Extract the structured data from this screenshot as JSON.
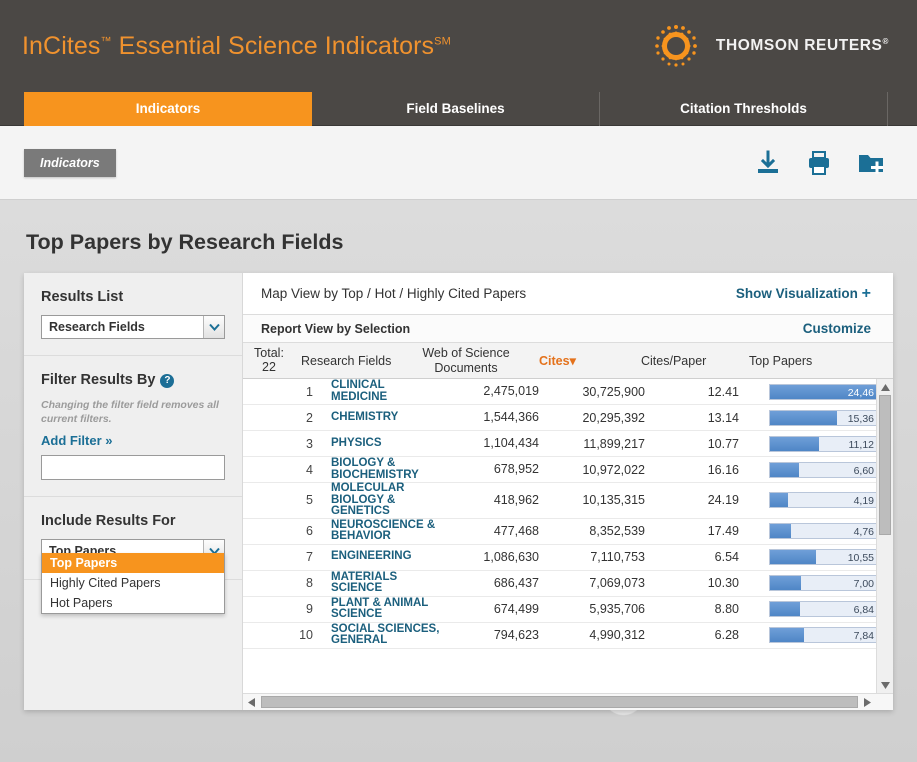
{
  "brand": {
    "product_incites": "InCites",
    "product_tm": "™",
    "product_esi": " Essential Science Indicators",
    "product_sm": "SM",
    "company": "THOMSON REUTERS",
    "company_tm": "®"
  },
  "tabs": [
    {
      "label": "Indicators",
      "active": true
    },
    {
      "label": "Field Baselines",
      "active": false
    },
    {
      "label": "Citation Thresholds",
      "active": false
    }
  ],
  "toolbar": {
    "breadcrumb": "Indicators",
    "icons": [
      {
        "name": "download-icon",
        "title": "Download"
      },
      {
        "name": "print-icon",
        "title": "Print"
      },
      {
        "name": "add-to-folder-icon",
        "title": "Add to folder"
      }
    ]
  },
  "page_title": "Top Papers by Research Fields",
  "sidebar": {
    "results_list": {
      "heading": "Results List",
      "selected": "Research Fields"
    },
    "filter": {
      "heading": "Filter Results By",
      "help_glyph": "?",
      "hint": "Changing the filter field removes all current filters.",
      "add_filter": "Add Filter »",
      "input_value": "",
      "input_placeholder": ""
    },
    "include_results": {
      "heading": "Include Results For",
      "selected": "Top Papers",
      "options": [
        {
          "label": "Top Papers",
          "selected": true
        },
        {
          "label": "Highly Cited Papers",
          "selected": false
        },
        {
          "label": "Hot Papers",
          "selected": false
        }
      ]
    }
  },
  "content": {
    "map_view_label": "Map View by Top / Hot / Highly Cited Papers",
    "show_visualization": "Show Visualization",
    "show_visualization_plus": "+",
    "report_view_label": "Report View by Selection",
    "customize": "Customize",
    "total_label": "Total:",
    "total_value": "22",
    "sort_caret": "▾"
  },
  "chart_data": {
    "type": "table",
    "title": "Top Papers by Research Fields",
    "columns": [
      "Total: 22",
      "Research Fields",
      "Web of Science Documents",
      "Cites",
      "Cites/Paper",
      "Top Papers"
    ],
    "sorted_by": "Cites",
    "sort_direction": "desc",
    "bar_column": "Top Papers",
    "bar_max": 24460,
    "rows": [
      {
        "rank": "1",
        "field": "CLINICAL MEDICINE",
        "wos": "2,475,019",
        "cites": "30,725,900",
        "cites_per_paper": "12.41",
        "top_papers": "24,46",
        "bar_pct": 100,
        "label_inside": true
      },
      {
        "rank": "2",
        "field": "CHEMISTRY",
        "wos": "1,544,366",
        "cites": "20,295,392",
        "cites_per_paper": "13.14",
        "top_papers": "15,36",
        "bar_pct": 63,
        "label_inside": false
      },
      {
        "rank": "3",
        "field": "PHYSICS",
        "wos": "1,104,434",
        "cites": "11,899,217",
        "cites_per_paper": "10.77",
        "top_papers": "11,12",
        "bar_pct": 46,
        "label_inside": false
      },
      {
        "rank": "4",
        "field": "BIOLOGY & BIOCHEMISTRY",
        "wos": "678,952",
        "cites": "10,972,022",
        "cites_per_paper": "16.16",
        "top_papers": "6,60",
        "bar_pct": 27,
        "label_inside": false
      },
      {
        "rank": "5",
        "field": "MOLECULAR BIOLOGY & GENETICS",
        "wos": "418,962",
        "cites": "10,135,315",
        "cites_per_paper": "24.19",
        "top_papers": "4,19",
        "bar_pct": 17,
        "label_inside": false
      },
      {
        "rank": "6",
        "field": "NEUROSCIENCE & BEHAVIOR",
        "wos": "477,468",
        "cites": "8,352,539",
        "cites_per_paper": "17.49",
        "top_papers": "4,76",
        "bar_pct": 20,
        "label_inside": false
      },
      {
        "rank": "7",
        "field": "ENGINEERING",
        "wos": "1,086,630",
        "cites": "7,110,753",
        "cites_per_paper": "6.54",
        "top_papers": "10,55",
        "bar_pct": 43,
        "label_inside": false
      },
      {
        "rank": "8",
        "field": "MATERIALS SCIENCE",
        "wos": "686,437",
        "cites": "7,069,073",
        "cites_per_paper": "10.30",
        "top_papers": "7,00",
        "bar_pct": 29,
        "label_inside": false
      },
      {
        "rank": "9",
        "field": "PLANT & ANIMAL SCIENCE",
        "wos": "674,499",
        "cites": "5,935,706",
        "cites_per_paper": "8.80",
        "top_papers": "6,84",
        "bar_pct": 28,
        "label_inside": false
      },
      {
        "rank": "10",
        "field": "SOCIAL SCIENCES, GENERAL",
        "wos": "794,623",
        "cites": "4,990,312",
        "cites_per_paper": "6.28",
        "top_papers": "7,84",
        "bar_pct": 32,
        "label_inside": false
      }
    ]
  },
  "colors": {
    "brand_orange": "#f7941e",
    "header_dark": "#4b4845",
    "link_blue": "#1b5f7d",
    "icon_blue": "#1b6f96",
    "bar_blue": "#4f86c6",
    "sort_orange": "#e4721c"
  }
}
